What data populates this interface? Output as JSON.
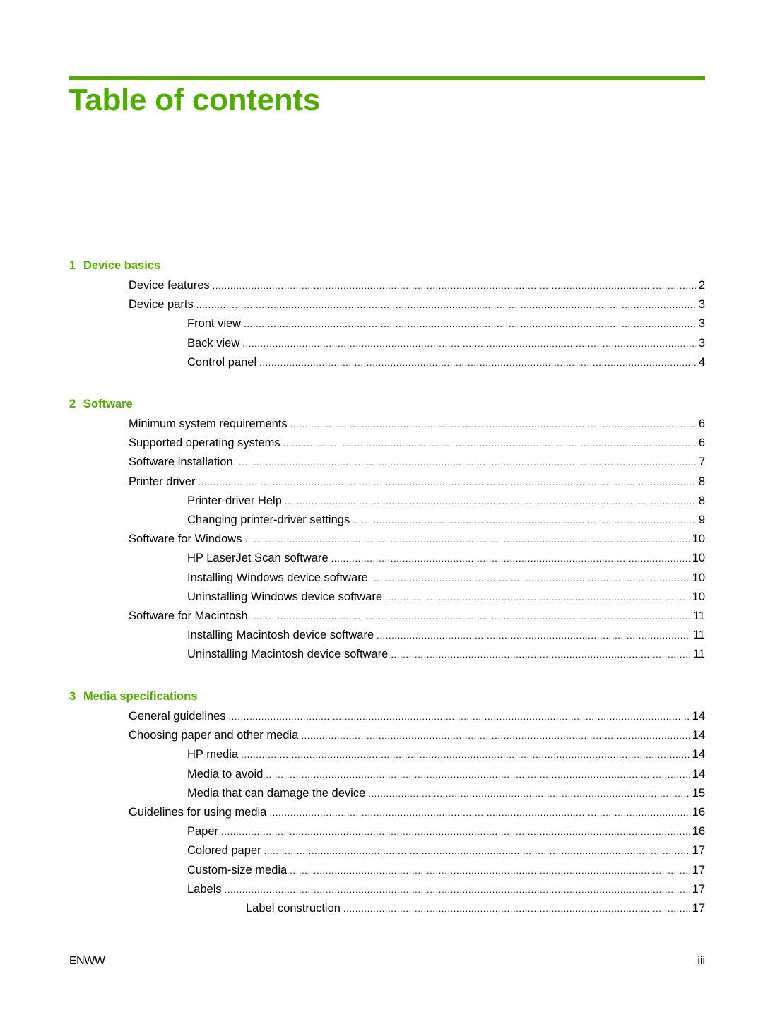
{
  "page": {
    "title": "Table of contents",
    "accent_color": "#4fad00",
    "footer": {
      "left": "ENWW",
      "right": "iii"
    }
  },
  "chapters": [
    {
      "number": "1",
      "title": "Device basics",
      "entries": [
        {
          "level": 1,
          "label": "Device features",
          "page": "2"
        },
        {
          "level": 1,
          "label": "Device parts",
          "page": "3"
        },
        {
          "level": 2,
          "label": "Front view",
          "page": "3"
        },
        {
          "level": 2,
          "label": "Back view",
          "page": "3"
        },
        {
          "level": 2,
          "label": "Control panel",
          "page": "4"
        }
      ]
    },
    {
      "number": "2",
      "title": "Software",
      "entries": [
        {
          "level": 1,
          "label": "Minimum system requirements",
          "page": "6"
        },
        {
          "level": 1,
          "label": "Supported operating systems",
          "page": "6"
        },
        {
          "level": 1,
          "label": "Software installation",
          "page": "7"
        },
        {
          "level": 1,
          "label": "Printer driver",
          "page": "8"
        },
        {
          "level": 2,
          "label": "Printer-driver Help",
          "page": "8"
        },
        {
          "level": 2,
          "label": "Changing printer-driver settings",
          "page": "9"
        },
        {
          "level": 1,
          "label": "Software for Windows",
          "page": "10"
        },
        {
          "level": 2,
          "label": "HP LaserJet Scan software",
          "page": "10"
        },
        {
          "level": 2,
          "label": "Installing Windows device software",
          "page": "10"
        },
        {
          "level": 2,
          "label": "Uninstalling Windows device software",
          "page": "10"
        },
        {
          "level": 1,
          "label": "Software for Macintosh",
          "page": "11"
        },
        {
          "level": 2,
          "label": "Installing Macintosh device software",
          "page": "11"
        },
        {
          "level": 2,
          "label": "Uninstalling Macintosh device software",
          "page": "11"
        }
      ]
    },
    {
      "number": "3",
      "title": "Media specifications",
      "entries": [
        {
          "level": 1,
          "label": "General guidelines",
          "page": "14"
        },
        {
          "level": 1,
          "label": "Choosing paper and other media",
          "page": "14"
        },
        {
          "level": 2,
          "label": "HP media",
          "page": "14"
        },
        {
          "level": 2,
          "label": "Media to avoid",
          "page": "14"
        },
        {
          "level": 2,
          "label": "Media that can damage the device",
          "page": "15"
        },
        {
          "level": 1,
          "label": "Guidelines for using media",
          "page": "16"
        },
        {
          "level": 2,
          "label": "Paper",
          "page": "16"
        },
        {
          "level": 2,
          "label": "Colored paper",
          "page": "17"
        },
        {
          "level": 2,
          "label": "Custom-size media",
          "page": "17"
        },
        {
          "level": 2,
          "label": "Labels",
          "page": "17"
        },
        {
          "level": 3,
          "label": "Label construction",
          "page": "17"
        }
      ]
    }
  ]
}
